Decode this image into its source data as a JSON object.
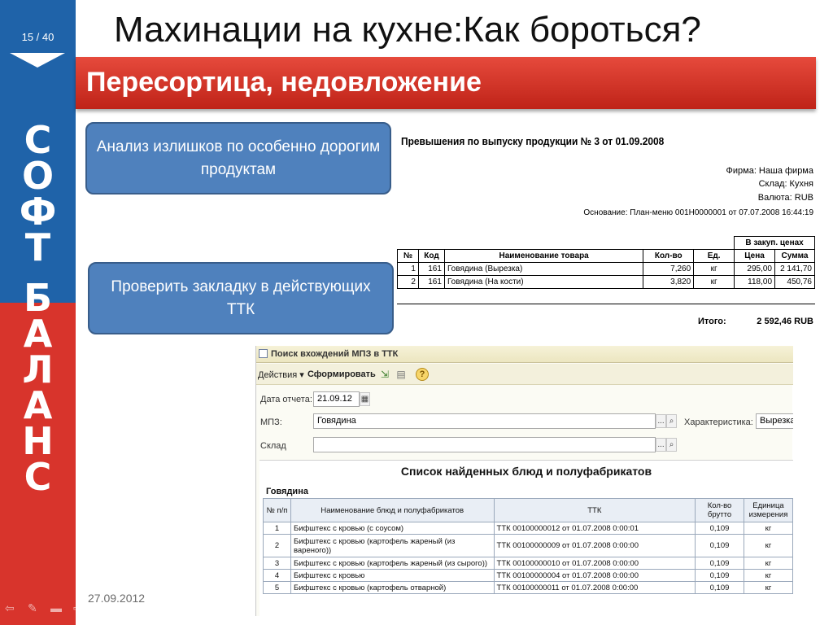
{
  "slide": {
    "counter": "15 / 40",
    "brand_letters": [
      "С",
      "О",
      "Ф",
      "Т",
      "Б",
      "А",
      "Л",
      "А",
      "Н",
      "С"
    ],
    "title": "Махинации на кухне:Как бороться?",
    "subtitle": "Пересортица, недовложение",
    "date": "27.09.2012"
  },
  "callouts": {
    "first": "Анализ излишков по особенно дорогим  продуктам",
    "second": "Проверить закладку в действующих ТТК"
  },
  "report1": {
    "title": "Превышения по выпуску продукции № 3 от 01.09.2008",
    "firm": "Фирма: Наша фирма",
    "warehouse": "Склад: Кухня",
    "currency": "Валюта: RUB",
    "basis": "Основание: План-меню 001Н0000001 от 07.07.2008 16:44:19",
    "table": {
      "group_header": "В закуп. ценах",
      "headers": [
        "№",
        "Код",
        "Наименование товара",
        "Кол-во",
        "Ед.",
        "Цена",
        "Сумма"
      ],
      "rows": [
        [
          "1",
          "161",
          "Говядина (Вырезка)",
          "7,260",
          "кг",
          "295,00",
          "2 141,70"
        ],
        [
          "2",
          "161",
          "Говядина (На кости)",
          "3,820",
          "кг",
          "118,00",
          "450,76"
        ]
      ]
    },
    "total_label": "Итого:",
    "total_value": "2 592,46 RUB"
  },
  "window": {
    "title": "Поиск вхождений МПЗ в ТТК",
    "toolbar": {
      "actions": "Действия ▾",
      "generate": "Сформировать"
    },
    "form": {
      "date_label": "Дата отчета:",
      "date_value": "21.09.12",
      "mpz_label": "МПЗ:",
      "mpz_value": "Говядина",
      "char_label": "Характеристика:",
      "char_value": "Вырезка",
      "warehouse_label": "Склад",
      "warehouse_value": ""
    },
    "list_title": "Список найденных блюд и полуфабрикатов",
    "group_label": "Говядина",
    "table": {
      "headers": [
        "№ п/п",
        "Наименование блюд и полуфабрикатов",
        "ТТК",
        "Кол-во брутто",
        "Единица измерения"
      ],
      "rows": [
        [
          "1",
          "Бифштекс с кровью (с  соусом)",
          "ТТК 00100000012 от 01.07.2008 0:00:01",
          "0,109",
          "кг"
        ],
        [
          "2",
          "Бифштекс с кровью (картофель жареный (из вареного))",
          "ТТК 00100000009 от 01.07.2008 0:00:00",
          "0,109",
          "кг"
        ],
        [
          "3",
          "Бифштекс с кровью (картофель жареный (из сырого))",
          "ТТК 00100000010 от 01.07.2008 0:00:00",
          "0,109",
          "кг"
        ],
        [
          "4",
          "Бифштекс с кровью",
          "ТТК 00100000004 от 01.07.2008 0:00:00",
          "0,109",
          "кг"
        ],
        [
          "5",
          "Бифштекс с кровью (картофель отварной)",
          "ТТК 00100000011 от 01.07.2008 0:00:00",
          "0,109",
          "кг"
        ]
      ]
    }
  },
  "icons": {
    "help": "?",
    "calendar": "▦",
    "ellipsis": "...",
    "search": "⌕"
  }
}
